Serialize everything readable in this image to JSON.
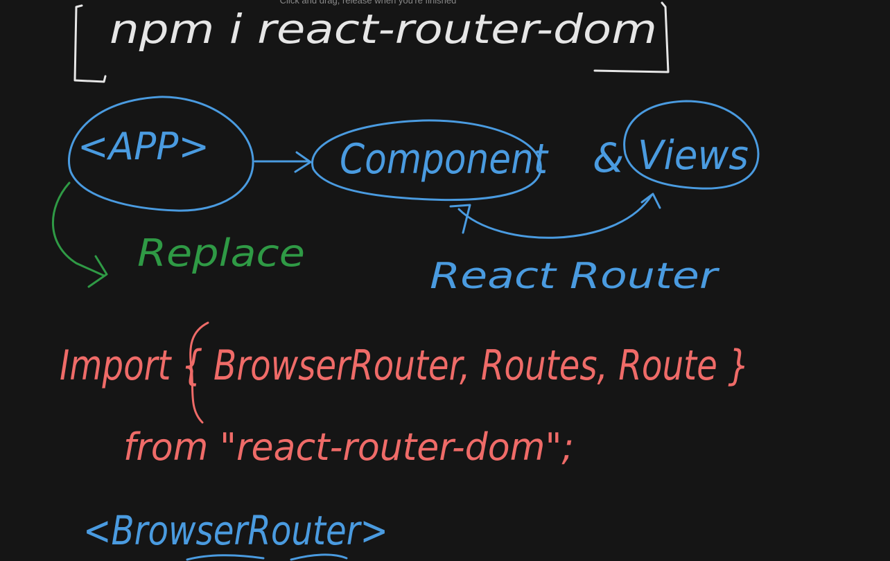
{
  "hint": "Click and drag, release when you're finished",
  "colors": {
    "background": "#151515",
    "white_ink": "#e6e6e6",
    "blue_ink": "#4a9be0",
    "green_ink": "#2f9a45",
    "red_ink": "#ef6b68"
  },
  "notes": {
    "install_command": "npm i react-router-dom",
    "app_node": "<APP>",
    "component_node": "Component",
    "views_node": "Views",
    "ampersand": "&",
    "replace_label": "Replace",
    "router_label": "React Router",
    "import_line": "Import { BrowserRouter, Routes, Route }",
    "from_line": "from \"react-router-dom\";",
    "browser_router_tag": "<BrowserRouter>"
  }
}
